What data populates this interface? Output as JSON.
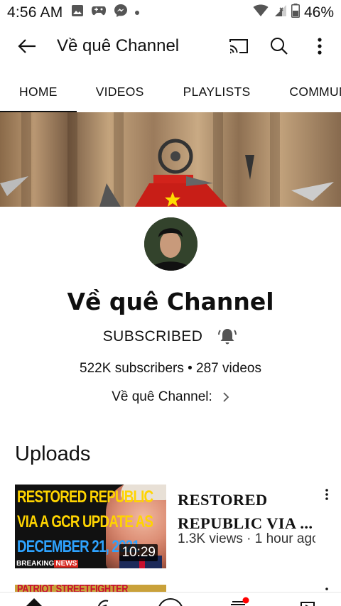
{
  "status_bar": {
    "time": "4:56 AM",
    "battery": "46%",
    "icons": [
      "image-icon",
      "game-controller-icon",
      "messenger-icon",
      "dot-icon",
      "wifi-icon",
      "signal-icon",
      "battery-icon"
    ]
  },
  "app_bar": {
    "title": "Về quê Channel",
    "icons": [
      "back-arrow-icon",
      "cast-icon",
      "search-icon",
      "more-vert-icon"
    ]
  },
  "tabs": [
    {
      "label": "HOME",
      "active": true
    },
    {
      "label": "VIDEOS",
      "active": false
    },
    {
      "label": "PLAYLISTS",
      "active": false
    },
    {
      "label": "COMMUNITY",
      "active": false
    }
  ],
  "channel": {
    "name": "Về quê Channel",
    "subscribe_label": "SUBSCRIBED",
    "stats": "522K subscribers • 287 videos",
    "link_text": "Về quê Channel:"
  },
  "uploads": {
    "title": "Uploads",
    "videos": [
      {
        "thumbnail_lines": [
          "RESTORED REPUBLIC",
          "VIA A GCR UPDATE AS",
          "DECEMBER 21, 2021"
        ],
        "thumbnail_tag_a": "BREAKING",
        "thumbnail_tag_b": "NEWS",
        "duration": "10:29",
        "title": "RESTORED REPUBLIC VIA ...",
        "meta": "1.3K views · 1 hour ago"
      },
      {
        "thumbnail_text": "PATRIOT STREETFIGHTER"
      }
    ]
  },
  "bottom_nav": {
    "icons": [
      "home-icon",
      "explore-icon",
      "add-icon",
      "subscriptions-icon",
      "library-icon"
    ],
    "notification_color": "#ff0000"
  },
  "colors": {
    "accent_red": "#ff0000",
    "thumb_yellow": "#ffd400",
    "thumb_blue": "#2ea3ff",
    "flag_red": "#d7261f"
  }
}
